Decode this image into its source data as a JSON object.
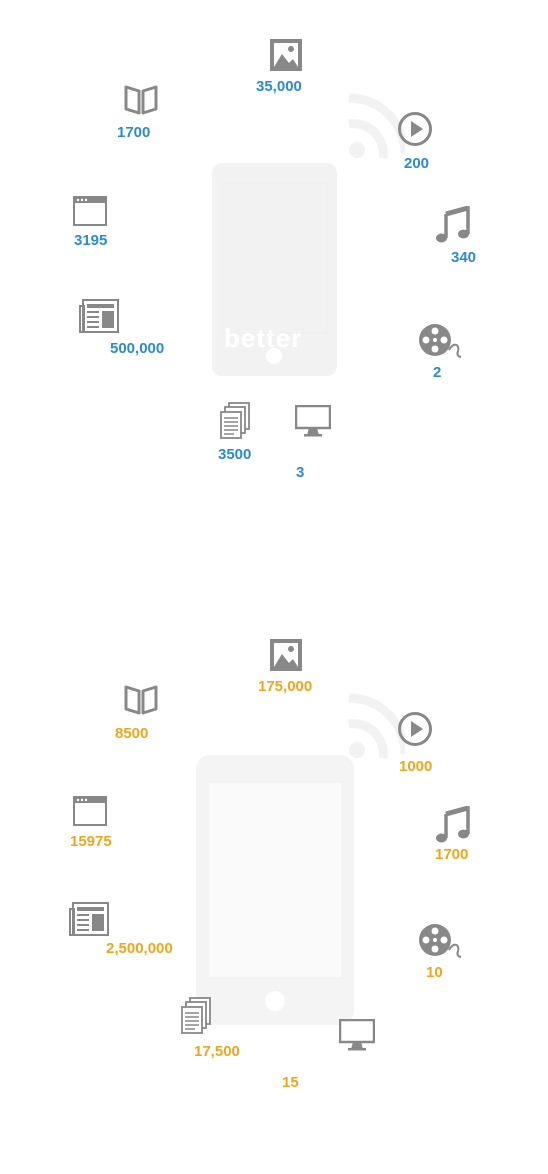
{
  "colors": {
    "icon": "#888888",
    "blue": "#2b8ad8",
    "orange": "#f5a41a",
    "ghost": "#f2f2f2"
  },
  "top_panel": {
    "phone_ghost_word": "better",
    "values": {
      "image": "35,000",
      "book": "1700",
      "play": "200",
      "browser": "3195",
      "music": "340",
      "news": "500,000",
      "film": "2",
      "documents": "3500",
      "monitor": "3"
    }
  },
  "bottom_panel": {
    "values": {
      "image": "175,000",
      "book": "8500",
      "play": "1000",
      "browser": "15975",
      "music": "1700",
      "news": "2,500,000",
      "film": "10",
      "documents": "17,500",
      "monitor": "15"
    }
  },
  "icons": [
    "image-icon",
    "book-icon",
    "play-icon",
    "browser-window-icon",
    "music-note-icon",
    "newspaper-icon",
    "film-reel-icon",
    "documents-icon",
    "monitor-icon",
    "wifi-signal-icon",
    "smartphone-icon"
  ]
}
